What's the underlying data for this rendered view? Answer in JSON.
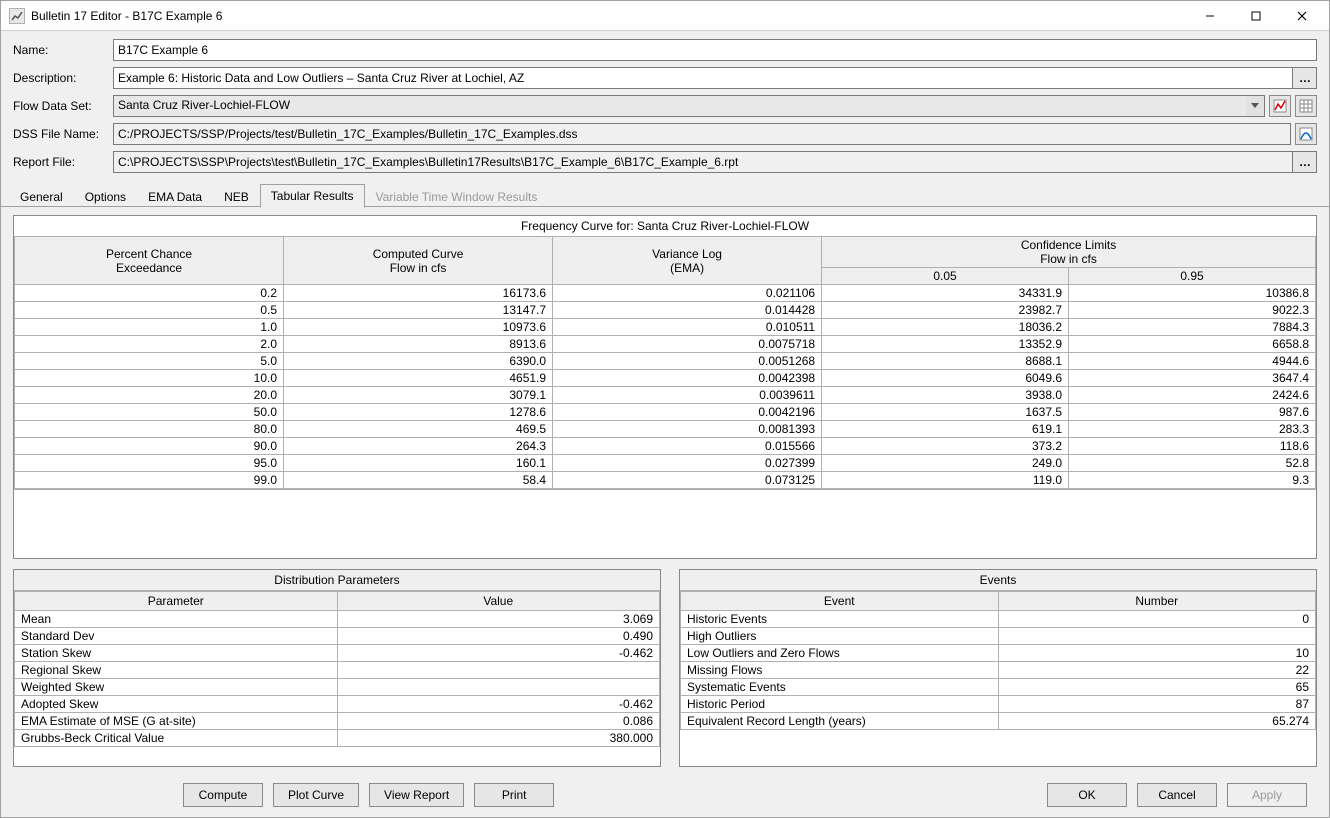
{
  "window": {
    "title": "Bulletin 17 Editor - B17C Example 6"
  },
  "fields": {
    "name_label": "Name:",
    "name_value": "B17C Example 6",
    "description_label": "Description:",
    "description_value": "Example 6: Historic Data and Low Outliers – Santa Cruz River at Lochiel, AZ",
    "flowset_label": "Flow Data Set:",
    "flowset_value": "Santa Cruz River-Lochiel-FLOW",
    "dssfile_label": "DSS File Name:",
    "dssfile_value": "C:/PROJECTS/SSP/Projects/test/Bulletin_17C_Examples/Bulletin_17C_Examples.dss",
    "reportfile_label": "Report File:",
    "reportfile_value": "C:\\PROJECTS\\SSP\\Projects\\test\\Bulletin_17C_Examples\\Bulletin17Results\\B17C_Example_6\\B17C_Example_6.rpt"
  },
  "tabs": {
    "general": "General",
    "options": "Options",
    "ema": "EMA Data",
    "neb": "NEB",
    "tabular": "Tabular Results",
    "variable": "Variable Time Window Results"
  },
  "freq": {
    "title": "Frequency Curve for: Santa Cruz River-Lochiel-FLOW",
    "headers": {
      "pce": "Percent Chance\nExceedance",
      "curve": "Computed Curve\nFlow in cfs",
      "varlog": "Variance Log\n(EMA)",
      "conf": "Confidence Limits\nFlow in cfs",
      "c05": "0.05",
      "c95": "0.95"
    },
    "rows": [
      {
        "pce": "0.2",
        "curve": "16173.6",
        "var": "0.021106",
        "c05": "34331.9",
        "c95": "10386.8"
      },
      {
        "pce": "0.5",
        "curve": "13147.7",
        "var": "0.014428",
        "c05": "23982.7",
        "c95": "9022.3"
      },
      {
        "pce": "1.0",
        "curve": "10973.6",
        "var": "0.010511",
        "c05": "18036.2",
        "c95": "7884.3"
      },
      {
        "pce": "2.0",
        "curve": "8913.6",
        "var": "0.0075718",
        "c05": "13352.9",
        "c95": "6658.8"
      },
      {
        "pce": "5.0",
        "curve": "6390.0",
        "var": "0.0051268",
        "c05": "8688.1",
        "c95": "4944.6"
      },
      {
        "pce": "10.0",
        "curve": "4651.9",
        "var": "0.0042398",
        "c05": "6049.6",
        "c95": "3647.4"
      },
      {
        "pce": "20.0",
        "curve": "3079.1",
        "var": "0.0039611",
        "c05": "3938.0",
        "c95": "2424.6"
      },
      {
        "pce": "50.0",
        "curve": "1278.6",
        "var": "0.0042196",
        "c05": "1637.5",
        "c95": "987.6"
      },
      {
        "pce": "80.0",
        "curve": "469.5",
        "var": "0.0081393",
        "c05": "619.1",
        "c95": "283.3"
      },
      {
        "pce": "90.0",
        "curve": "264.3",
        "var": "0.015566",
        "c05": "373.2",
        "c95": "118.6"
      },
      {
        "pce": "95.0",
        "curve": "160.1",
        "var": "0.027399",
        "c05": "249.0",
        "c95": "52.8"
      },
      {
        "pce": "99.0",
        "curve": "58.4",
        "var": "0.073125",
        "c05": "119.0",
        "c95": "9.3"
      }
    ]
  },
  "dist": {
    "title": "Distribution Parameters",
    "col_param": "Parameter",
    "col_value": "Value",
    "rows": [
      {
        "p": "Mean",
        "v": "3.069"
      },
      {
        "p": "Standard Dev",
        "v": "0.490"
      },
      {
        "p": "Station Skew",
        "v": "-0.462"
      },
      {
        "p": "Regional Skew",
        "v": ""
      },
      {
        "p": "Weighted Skew",
        "v": ""
      },
      {
        "p": "Adopted Skew",
        "v": "-0.462"
      },
      {
        "p": "EMA Estimate of MSE (G at-site)",
        "v": "0.086"
      },
      {
        "p": "Grubbs-Beck Critical Value",
        "v": "380.000"
      }
    ]
  },
  "events": {
    "title": "Events",
    "col_event": "Event",
    "col_number": "Number",
    "rows": [
      {
        "e": "Historic Events",
        "n": "0"
      },
      {
        "e": "High Outliers",
        "n": ""
      },
      {
        "e": "Low Outliers and Zero Flows",
        "n": "10"
      },
      {
        "e": "Missing Flows",
        "n": "22"
      },
      {
        "e": "Systematic Events",
        "n": "65"
      },
      {
        "e": "Historic Period",
        "n": "87"
      },
      {
        "e": "Equivalent Record Length (years)",
        "n": "65.274"
      }
    ]
  },
  "buttons": {
    "compute": "Compute",
    "plot": "Plot Curve",
    "view": "View Report",
    "print": "Print",
    "ok": "OK",
    "cancel": "Cancel",
    "apply": "Apply"
  }
}
